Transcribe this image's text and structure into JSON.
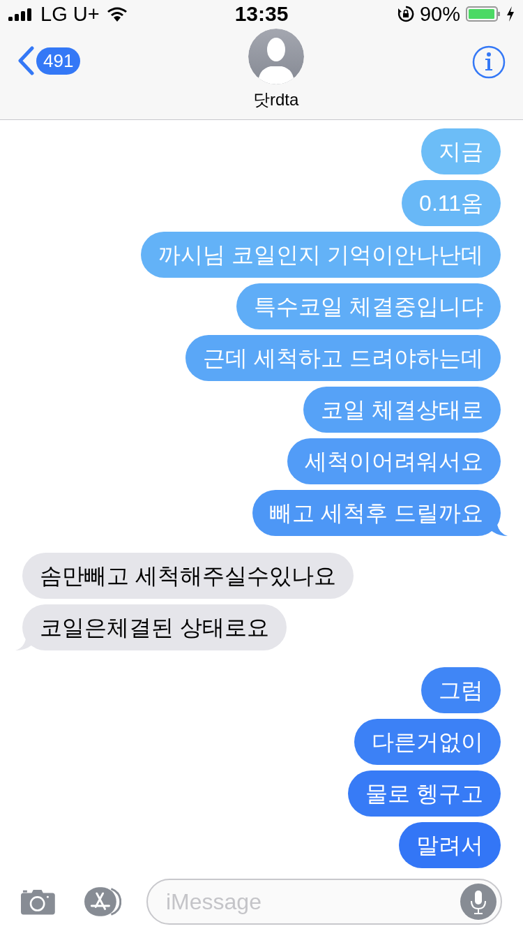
{
  "status_bar": {
    "carrier": "LG U+",
    "time": "13:35",
    "battery": "90%"
  },
  "header": {
    "back_count": "491",
    "contact": "닷rdta"
  },
  "messages": [
    {
      "kind": "sent",
      "text": "지금",
      "tail": false
    },
    {
      "kind": "sent",
      "text": "0.11옴",
      "tail": false
    },
    {
      "kind": "sent",
      "text": "까시님 코일인지 기억이안나난데",
      "tail": false
    },
    {
      "kind": "sent",
      "text": "특수코일 체결중입니댜",
      "tail": false
    },
    {
      "kind": "sent",
      "text": "근데 세척하고 드려야하는데",
      "tail": false
    },
    {
      "kind": "sent",
      "text": "코일 체결상태로",
      "tail": false
    },
    {
      "kind": "sent",
      "text": "세척이어려워서요",
      "tail": false
    },
    {
      "kind": "sent",
      "text": "빼고 세척후 드릴까요",
      "tail": true
    },
    {
      "kind": "received",
      "text": "솜만빼고 세척해주실수있나요",
      "tail": false
    },
    {
      "kind": "received",
      "text": "코일은체결된 상태로요",
      "tail": true
    },
    {
      "kind": "sent",
      "text": "그럼",
      "tail": false
    },
    {
      "kind": "sent",
      "text": "다른거없이",
      "tail": false
    },
    {
      "kind": "sent",
      "text": "물로 헹구고",
      "tail": false
    },
    {
      "kind": "sent",
      "text": "말려서",
      "tail": false
    }
  ],
  "composer": {
    "placeholder": "iMessage"
  }
}
